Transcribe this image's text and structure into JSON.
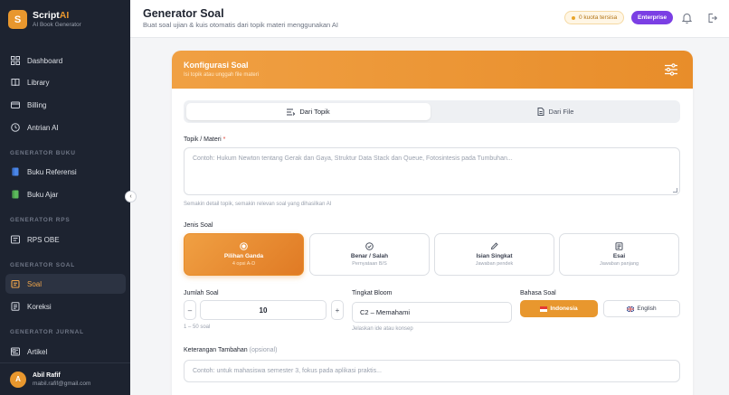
{
  "brand": {
    "logo_letter": "S",
    "name": "Script",
    "name_accent": "AI",
    "subtitle": "AI Book Generator"
  },
  "sidebar": {
    "main": [
      {
        "label": "Dashboard",
        "icon": "grid-icon"
      },
      {
        "label": "Library",
        "icon": "book-icon"
      },
      {
        "label": "Billing",
        "icon": "card-icon"
      },
      {
        "label": "Antrian AI",
        "icon": "clock-icon"
      }
    ],
    "sections": [
      {
        "title": "GENERATOR BUKU",
        "items": [
          {
            "label": "Buku Referensi"
          },
          {
            "label": "Buku Ajar"
          }
        ]
      },
      {
        "title": "GENERATOR RPS",
        "items": [
          {
            "label": "RPS OBE"
          }
        ]
      },
      {
        "title": "GENERATOR SOAL",
        "items": [
          {
            "label": "Soal",
            "active": true
          },
          {
            "label": "Koreksi"
          }
        ]
      },
      {
        "title": "GENERATOR JURNAL",
        "items": [
          {
            "label": "Artikel"
          }
        ]
      }
    ],
    "collapse_glyph": "‹"
  },
  "user": {
    "initial": "A",
    "name": "Abil Rafif",
    "email": "mabil.rafif@gmail.com"
  },
  "header": {
    "title": "Generator Soal",
    "subtitle": "Buat soal ujian & kuis otomatis dari topik materi menggunakan AI",
    "quota": "0 kuota tersisa",
    "plan": "Enterprise"
  },
  "card": {
    "title": "Konfigurasi Soal",
    "subtitle": "Isi topik atau unggah file materi",
    "tabs": {
      "topic": "Dari Topik",
      "file": "Dari File"
    },
    "topic_label": "Topik / Materi",
    "topic_required": "*",
    "topic_placeholder": "Contoh: Hukum Newton tentang Gerak dan Gaya, Struktur Data Stack dan Queue, Fotosintesis pada Tumbuhan...",
    "topic_hint": "Semakin detail topik, semakin relevan soal yang dihasilkan AI",
    "type_label": "Jenis Soal",
    "types": [
      {
        "title": "Pilihan Ganda",
        "sub": "4 opsi A-D",
        "active": true
      },
      {
        "title": "Benar / Salah",
        "sub": "Pernyataan B/S"
      },
      {
        "title": "Isian Singkat",
        "sub": "Jawaban pendek"
      },
      {
        "title": "Esai",
        "sub": "Jawaban panjang"
      }
    ],
    "count_label": "Jumlah Soal",
    "count_value": "10",
    "count_minus": "–",
    "count_plus": "+",
    "count_hint": "1 – 50 soal",
    "bloom_label": "Tingkat Bloom",
    "bloom_value": "C2 – Memahami",
    "bloom_hint": "Jelaskan ide atau konsep",
    "lang_label": "Bahasa Soal",
    "lang_id": "Indonesia",
    "lang_en": "English",
    "extra_label": "Keterangan Tambahan",
    "extra_optional": "(opsional)",
    "extra_placeholder": "Contoh: untuk mahasiswa semester 3, fokus pada aplikasi praktis..."
  },
  "colors": {
    "accent": "#e8972e",
    "sidebar_bg": "#1d2330",
    "plan": "#7b3fe4"
  }
}
